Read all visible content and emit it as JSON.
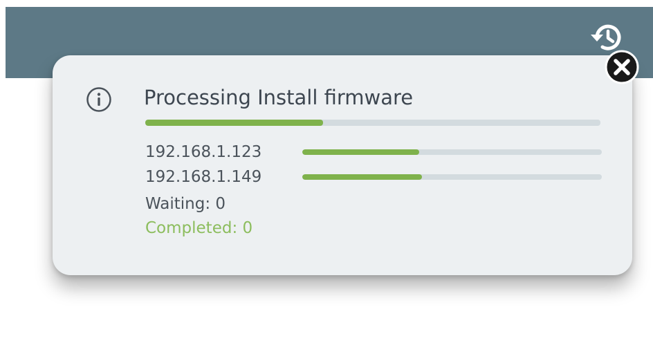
{
  "header": {
    "history_icon": "history-icon"
  },
  "popup": {
    "title": "Processing Install firmware",
    "info_icon": "info-icon",
    "close_icon": "close-icon",
    "overall_progress": 0.39,
    "hosts": [
      {
        "address": "192.168.1.123",
        "progress": 0.39
      },
      {
        "address": "192.168.1.149",
        "progress": 0.4
      }
    ],
    "waiting_text": "Waiting: 0",
    "completed_text": "Completed: 0"
  },
  "colors": {
    "header": "#5d7986",
    "progress_fill": "#7fb24c",
    "progress_track": "#d3dbdf",
    "completed_text": "#8cbd5d",
    "popup_background": "#edf0f2"
  }
}
